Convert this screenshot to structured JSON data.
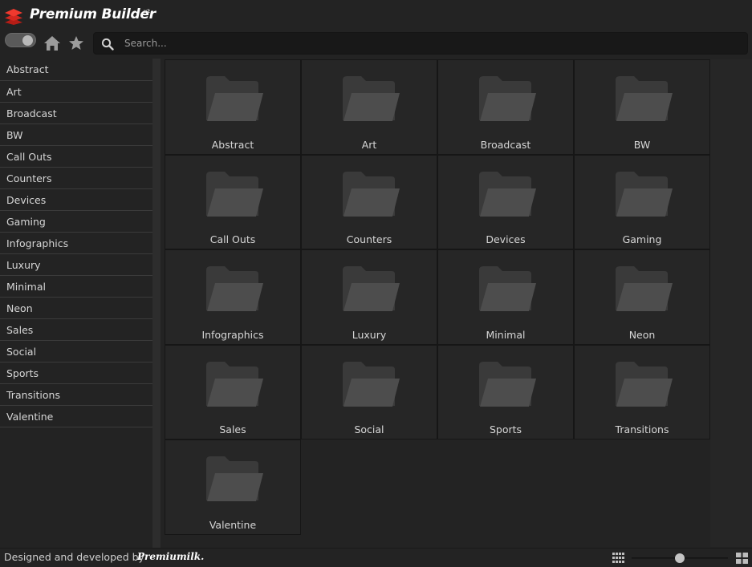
{
  "app": {
    "title": "Premium Builder",
    "version": "v2",
    "brand_color": "#e8332a"
  },
  "toolbar": {
    "toggle_state": "on",
    "home_icon": "home-icon",
    "favorites_icon": "star-icon",
    "search_icon": "search-icon",
    "search_placeholder": "Search...",
    "search_value": ""
  },
  "sidebar": {
    "items": [
      {
        "label": "Abstract"
      },
      {
        "label": "Art"
      },
      {
        "label": "Broadcast"
      },
      {
        "label": "BW"
      },
      {
        "label": "Call Outs"
      },
      {
        "label": "Counters"
      },
      {
        "label": "Devices"
      },
      {
        "label": "Gaming"
      },
      {
        "label": "Infographics"
      },
      {
        "label": "Luxury"
      },
      {
        "label": "Minimal"
      },
      {
        "label": "Neon"
      },
      {
        "label": "Sales"
      },
      {
        "label": "Social"
      },
      {
        "label": "Sports"
      },
      {
        "label": "Transitions"
      },
      {
        "label": "Valentine"
      }
    ]
  },
  "grid": {
    "folder_icon": "folder-icon",
    "tiles": [
      {
        "label": "Abstract"
      },
      {
        "label": "Art"
      },
      {
        "label": "Broadcast"
      },
      {
        "label": "BW"
      },
      {
        "label": "Call Outs"
      },
      {
        "label": "Counters"
      },
      {
        "label": "Devices"
      },
      {
        "label": "Gaming"
      },
      {
        "label": "Infographics"
      },
      {
        "label": "Luxury"
      },
      {
        "label": "Minimal"
      },
      {
        "label": "Neon"
      },
      {
        "label": "Sales"
      },
      {
        "label": "Social"
      },
      {
        "label": "Sports"
      },
      {
        "label": "Transitions"
      },
      {
        "label": "Valentine"
      }
    ]
  },
  "footer": {
    "credit_text": "Designed and developed by",
    "brand_name": "Premiumilk.",
    "thumbnail_size_fraction": 0.5,
    "small_grid_icon": "grid-small-icon",
    "large_grid_icon": "grid-large-icon"
  }
}
